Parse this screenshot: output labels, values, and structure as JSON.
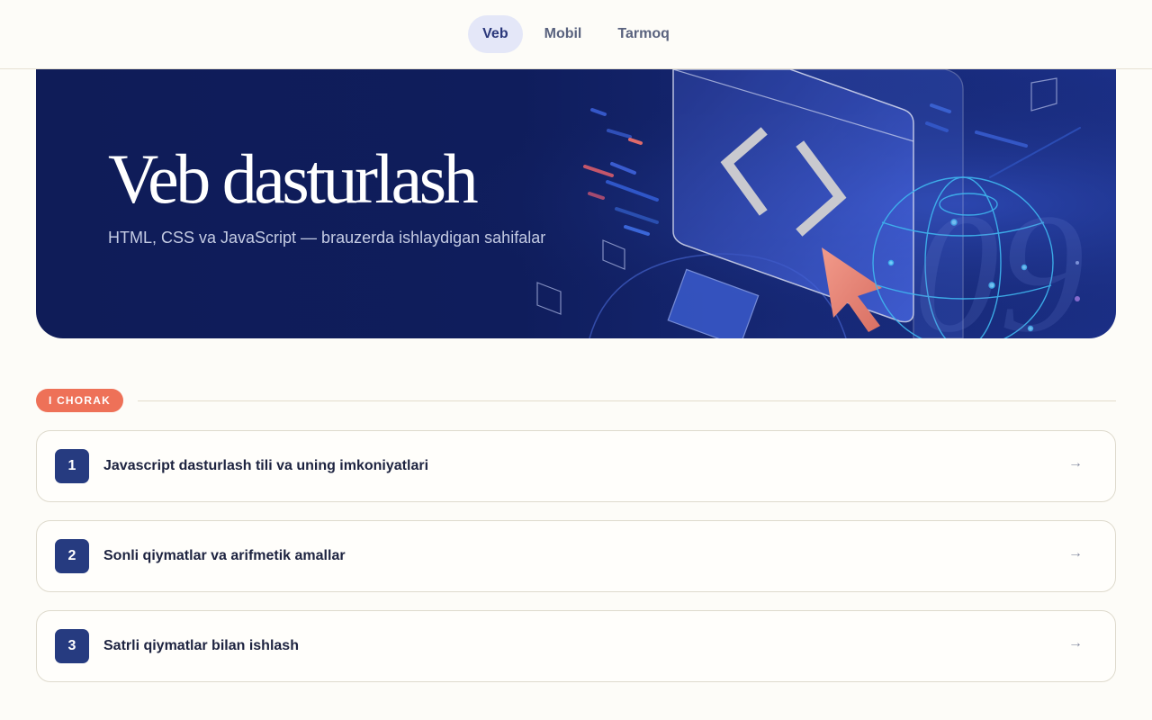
{
  "nav": {
    "tabs": [
      {
        "label": "Veb",
        "active": true
      },
      {
        "label": "Mobil",
        "active": false
      },
      {
        "label": "Tarmoq",
        "active": false
      }
    ]
  },
  "hero": {
    "title": "Veb dasturlash",
    "subtitle": "HTML, CSS va JavaScript — brauzerda ishlaydigan sahifalar",
    "illustration": [
      "code-window-icon",
      "code-brackets-icon",
      "cursor-arrow-icon",
      "globe-icon"
    ]
  },
  "section": {
    "badge": "I CHORAK"
  },
  "lessons": [
    {
      "number": "1",
      "title": "Javascript dasturlash tili va uning imkoniyatlari",
      "arrow": "→"
    },
    {
      "number": "2",
      "title": "Sonli qiymatlar va arifmetik amallar",
      "arrow": "→"
    },
    {
      "number": "3",
      "title": "Satrli qiymatlar bilan ishlash",
      "arrow": "→"
    }
  ],
  "colors": {
    "background": "#fdfcf8",
    "hero": "#0f1c58",
    "accent": "#ee7158",
    "primary": "#263b80",
    "active_tab_bg": "#e4e7f8"
  }
}
